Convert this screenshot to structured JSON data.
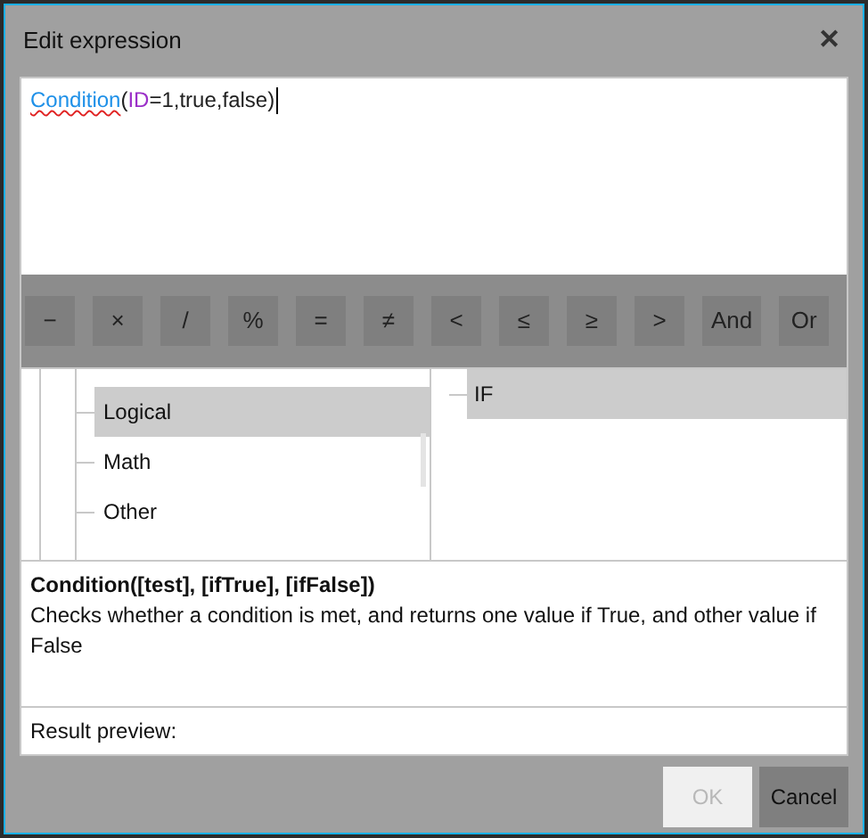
{
  "window": {
    "title": "Edit expression",
    "close": "✕"
  },
  "expression": [
    {
      "kind": "function",
      "text": "Condition",
      "spellcheck_error": true
    },
    {
      "kind": "plain",
      "text": "("
    },
    {
      "kind": "field",
      "text": "ID"
    },
    {
      "kind": "plain",
      "text": "=1,true,false)"
    }
  ],
  "operators": [
    "−",
    "×",
    "/",
    "%",
    "=",
    "≠",
    "<",
    "≤",
    "≥",
    ">",
    "And",
    "Or"
  ],
  "categories": [
    {
      "label": "Logical",
      "selected": true
    },
    {
      "label": "Math",
      "selected": false
    },
    {
      "label": "Other",
      "selected": false
    }
  ],
  "functions": [
    {
      "label": "IF",
      "selected": true
    }
  ],
  "description": {
    "signature": "Condition([test], [ifTrue], [ifFalse])",
    "text": "Checks whether a condition is met, and returns one value if True, and other value if False"
  },
  "result_preview": {
    "label": "Result preview:"
  },
  "buttons": [
    {
      "label": "OK",
      "disabled": true
    },
    {
      "label": "Cancel",
      "disabled": false
    }
  ]
}
